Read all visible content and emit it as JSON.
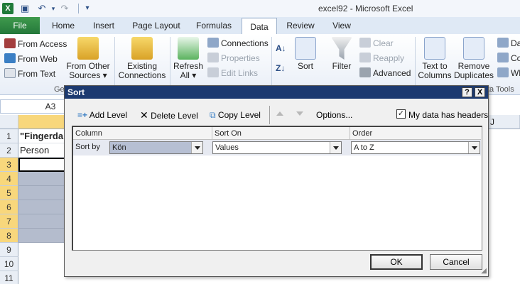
{
  "window": {
    "title": "excel92 - Microsoft Excel"
  },
  "qat": {
    "save_icon": "save-icon",
    "undo_icon": "undo-icon",
    "redo_icon": "redo-icon",
    "customize_icon": "customize-qat-icon"
  },
  "tabs": [
    {
      "label": "File"
    },
    {
      "label": "Home"
    },
    {
      "label": "Insert"
    },
    {
      "label": "Page Layout"
    },
    {
      "label": "Formulas"
    },
    {
      "label": "Data"
    },
    {
      "label": "Review"
    },
    {
      "label": "View"
    }
  ],
  "ribbon": {
    "external": {
      "from_access": "From Access",
      "from_web": "From Web",
      "from_text": "From Text",
      "from_other_1": "From Other",
      "from_other_2": "Sources ▾",
      "group_label": "Ge"
    },
    "existing": {
      "line1": "Existing",
      "line2": "Connections"
    },
    "connections": {
      "refresh_1": "Refresh",
      "refresh_2": "All ▾",
      "connections": "Connections",
      "properties": "Properties",
      "edit_links": "Edit Links"
    },
    "sort_filter": {
      "sort": "Sort",
      "filter": "Filter",
      "clear": "Clear",
      "reapply": "Reapply",
      "advanced": "Advanced"
    },
    "data_tools": {
      "ttc_1": "Text to",
      "ttc_2": "Columns",
      "rd_1": "Remove",
      "rd_2": "Duplicates",
      "cut_1": "Da",
      "cut_2": "Co",
      "cut_3": "Wh",
      "group_label": "ta Tools"
    }
  },
  "sheet": {
    "name_box": "A3",
    "rows": [
      "1",
      "2",
      "3",
      "4",
      "5",
      "6",
      "7",
      "8",
      "9",
      "10",
      "11"
    ],
    "col_j": "J",
    "a1": "\"Fingerda",
    "a2": "Person"
  },
  "sort_dialog": {
    "title": "Sort",
    "help": "?",
    "close": "X",
    "add_level": "Add Level",
    "delete_level": "Delete Level",
    "copy_level": "Copy Level",
    "options": "Options...",
    "has_headers_label": "My data has headers",
    "has_headers_checked": "✓",
    "headers": {
      "column": "Column",
      "sort_on": "Sort On",
      "order": "Order"
    },
    "level1": {
      "label": "Sort by",
      "column": "Kön",
      "sort_on": "Values",
      "order": "A to Z"
    },
    "ok": "OK",
    "cancel": "Cancel"
  }
}
